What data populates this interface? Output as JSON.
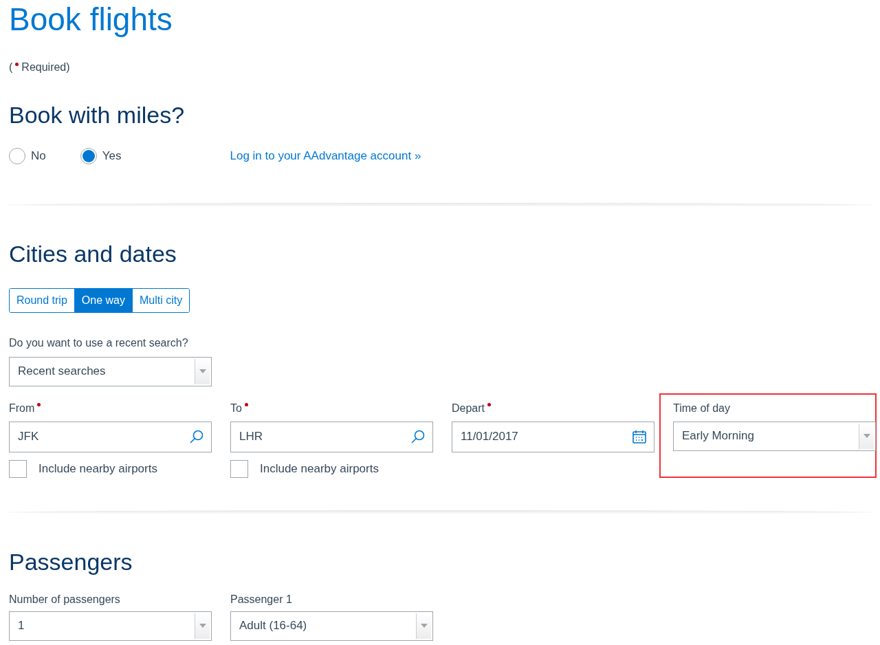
{
  "title": "Book flights",
  "required_note": {
    "prefix": "(",
    "suffix": "Required)"
  },
  "miles": {
    "heading": "Book with miles?",
    "options": [
      {
        "label": "No",
        "selected": false
      },
      {
        "label": "Yes",
        "selected": true
      }
    ],
    "link": "Log in to your AAdvantage account »"
  },
  "cities": {
    "heading": "Cities and dates",
    "trip_types": [
      {
        "label": "Round trip",
        "selected": false
      },
      {
        "label": "One way",
        "selected": true
      },
      {
        "label": "Multi city",
        "selected": false
      }
    ],
    "recent": {
      "label": "Do you want to use a recent search?",
      "value": "Recent searches"
    },
    "fields": [
      {
        "kind": "airport",
        "label": "From",
        "required": true,
        "value": "JFK",
        "highlighted": false,
        "nearby": {
          "label": "Include nearby airports",
          "checked": false
        }
      },
      {
        "kind": "airport",
        "label": "To",
        "required": true,
        "value": "LHR",
        "highlighted": false,
        "nearby": {
          "label": "Include nearby airports",
          "checked": false
        }
      },
      {
        "kind": "date",
        "label": "Depart",
        "required": true,
        "value": "11/01/2017",
        "highlighted": false
      },
      {
        "kind": "select",
        "label": "Time of day",
        "required": false,
        "value": "Early Morning",
        "highlighted": true
      }
    ]
  },
  "passengers": {
    "heading": "Passengers",
    "fields": [
      {
        "label": "Number of passengers",
        "value": "1"
      },
      {
        "label": "Passenger 1",
        "value": "Adult (16-64)"
      }
    ]
  }
}
